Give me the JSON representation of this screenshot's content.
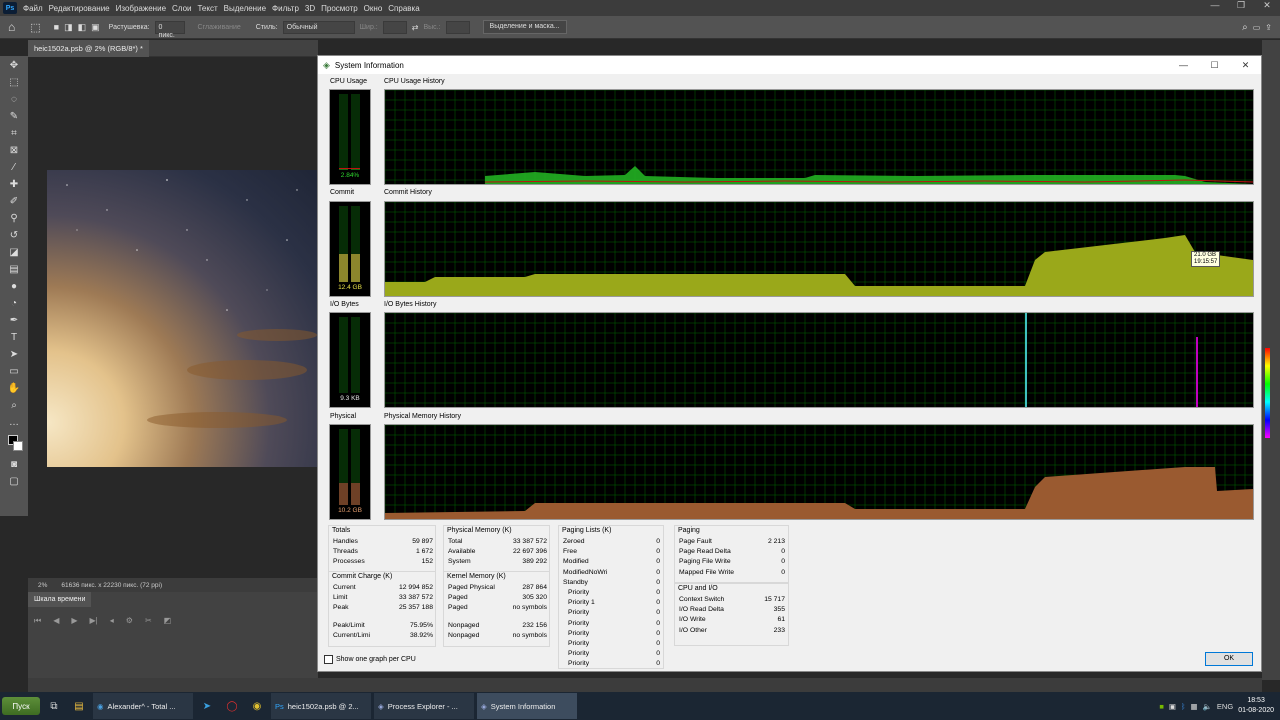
{
  "photoshop": {
    "logo": "Ps",
    "menu": [
      "Файл",
      "Редактирование",
      "Изображение",
      "Слои",
      "Текст",
      "Выделение",
      "Фильтр",
      "3D",
      "Просмотр",
      "Окно",
      "Справка"
    ],
    "options": {
      "feather_label": "Растушевка:",
      "feather_value": "0 пикс.",
      "antialias_label": "Сглаживание",
      "style_label": "Стиль:",
      "style_value": "Обычный",
      "width_label": "Шир.:",
      "height_label": "Выс.:",
      "select_mask_btn": "Выделение и маска..."
    },
    "doc_tab": "heic1502a.psb @ 2% (RGB/8*) *",
    "status": {
      "zoom": "2%",
      "size": "61636 пикс. x 22230 пикс. (72 ppi)"
    },
    "timeline_tab": "Шкала времени"
  },
  "sysinfo": {
    "title": "System Information",
    "close_label": "OK",
    "checkbox_label": "Show one graph per CPU",
    "graphs": {
      "cpu_label": "CPU Usage",
      "cpu_hist_label": "CPU Usage History",
      "cpu_value": "2.84%",
      "commit_label": "Commit",
      "commit_hist_label": "Commit History",
      "commit_value": "12.4 GB",
      "io_label": "I/O Bytes",
      "io_hist_label": "I/O Bytes History",
      "io_value": "9.3  KB",
      "phys_label": "Physical",
      "phys_hist_label": "Physical Memory History",
      "phys_value": "10.2 GB",
      "tooltip_l1": "21.0 GB",
      "tooltip_l2": "19:15:57"
    },
    "totals": {
      "title": "Totals",
      "rows": [
        {
          "k": "Handles",
          "v": "59 897"
        },
        {
          "k": "Threads",
          "v": "1 672"
        },
        {
          "k": "Processes",
          "v": "152"
        }
      ]
    },
    "commit_charge": {
      "title": "Commit Charge (K)",
      "rows": [
        {
          "k": "Current",
          "v": "12 994 852"
        },
        {
          "k": "Limit",
          "v": "33 387 572"
        },
        {
          "k": "Peak",
          "v": "25 357 188"
        },
        {
          "k": "Peak/Limit",
          "v": "75.95%"
        },
        {
          "k": "Current/Limi",
          "v": "38.92%"
        }
      ]
    },
    "physical_memory": {
      "title": "Physical Memory (K)",
      "rows": [
        {
          "k": "Total",
          "v": "33 387 572"
        },
        {
          "k": "Available",
          "v": "22 697 396"
        },
        {
          "k": "System",
          "v": "389 292"
        }
      ]
    },
    "kernel_memory": {
      "title": "Kernel Memory (K)",
      "rows": [
        {
          "k": "Paged Physical",
          "v": "287 864"
        },
        {
          "k": "Paged",
          "v": "305 320"
        },
        {
          "k": "Paged",
          "v": "no symbols"
        },
        {
          "k": "Nonpaged",
          "v": "232 156"
        },
        {
          "k": "Nonpaged",
          "v": "no symbols"
        }
      ]
    },
    "paging_lists": {
      "title": "Paging Lists (K)",
      "rows": [
        {
          "k": "Zeroed",
          "v": "0"
        },
        {
          "k": "Free",
          "v": "0"
        },
        {
          "k": "Modified",
          "v": "0"
        },
        {
          "k": "ModifiedNoWri",
          "v": "0"
        },
        {
          "k": "Standby",
          "v": "0"
        },
        {
          "k": "Priority",
          "v": "0"
        },
        {
          "k": "Priority 1",
          "v": "0"
        },
        {
          "k": "Priority",
          "v": "0"
        },
        {
          "k": "Priority",
          "v": "0"
        },
        {
          "k": "Priority",
          "v": "0"
        },
        {
          "k": "Priority",
          "v": "0"
        },
        {
          "k": "Priority",
          "v": "0"
        },
        {
          "k": "Priority",
          "v": "0"
        }
      ]
    },
    "paging": {
      "title": "Paging",
      "rows": [
        {
          "k": "Page Fault",
          "v": "2 213"
        },
        {
          "k": "Page Read Delta",
          "v": "0"
        },
        {
          "k": "Paging File Write",
          "v": "0"
        },
        {
          "k": "Mapped File Write",
          "v": "0"
        }
      ]
    },
    "cpu_io": {
      "title": "CPU and I/O",
      "rows": [
        {
          "k": "Context Switch",
          "v": "15 717"
        },
        {
          "k": "I/O Read Delta",
          "v": "355"
        },
        {
          "k": "I/O Write",
          "v": "61"
        },
        {
          "k": "I/O Other",
          "v": "233"
        }
      ]
    },
    "meters": {
      "cpu": 0.03,
      "commit": 0.37,
      "io": 0.0,
      "physical": 0.31
    },
    "colors": {
      "grid": "#006400",
      "cpu": "#22b022",
      "cpu_kernel": "#c01010",
      "commit": "#9aa81a",
      "io_read": "#40c0c0",
      "io_write": "#c000c0",
      "physical": "#9a5a30"
    }
  },
  "taskbar": {
    "start": "Пуск",
    "tasks": [
      {
        "label": "Alexander^ - Total ..."
      },
      {
        "label": "heic1502a.psb @ 2..."
      },
      {
        "label": "Process Explorer - ..."
      },
      {
        "label": "System Information"
      }
    ],
    "lang": "ENG",
    "time": "18:53",
    "date": "01-08-2020"
  }
}
